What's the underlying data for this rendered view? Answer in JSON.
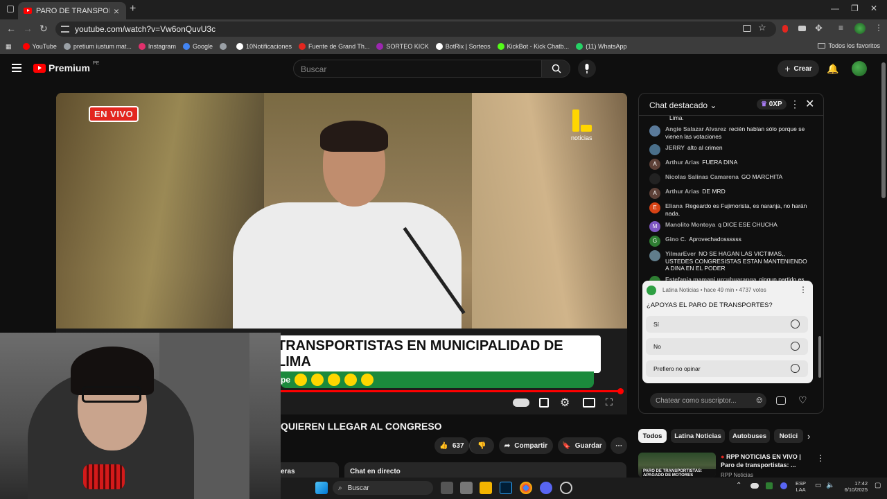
{
  "browser": {
    "tab_title": "PARO DE TRANSPORTE EN LIMA",
    "new_tab": "+",
    "url": "youtube.com/watch?v=Vw6onQuvU3c",
    "bookmarks": [
      {
        "label": "YouTube",
        "color": "#ff0000"
      },
      {
        "label": "pretium iustum mat...",
        "color": "#9aa0a6"
      },
      {
        "label": "Instagram",
        "color": "#e1306c"
      },
      {
        "label": "Google",
        "color": "#4285f4"
      },
      {
        "label": "",
        "color": "#9aa0a6"
      },
      {
        "label": "10Notificaciones",
        "color": "#ffffff"
      },
      {
        "label": "Fuente de Grand Th...",
        "color": "#e3261f"
      },
      {
        "label": "SORTEO KICK",
        "color": "#9c27b0"
      },
      {
        "label": "BotRix | Sorteos",
        "color": "#ffffff"
      },
      {
        "label": "KickBot - Kick Chatb...",
        "color": "#53fc18"
      },
      {
        "label": "(11) WhatsApp",
        "color": "#25d366"
      }
    ],
    "all_bookmarks": "Todos los favoritos"
  },
  "youtube": {
    "brand": "Premium",
    "region": "PE",
    "search_placeholder": "Buscar",
    "create_label": "Crear"
  },
  "video": {
    "live_badge": "EN VIVO",
    "channel_logo_text": "noticias",
    "headline_text": "TRANSPORTISTAS EN MUNICIPALIDAD DE LIMA",
    "social_prefix": "pe",
    "title": "QUIEREN LLEGAR AL CONGRESO",
    "likes": "637",
    "share_label": "Compartir",
    "save_label": "Guardar",
    "desc_tab": "eras",
    "chat_live_label": "Chat en directo"
  },
  "chat": {
    "title": "Chat destacado",
    "xp": "0XP",
    "messages": [
      {
        "author": "",
        "text": "Lima.",
        "avatar": "",
        "color": "transparent"
      },
      {
        "author": "Angie Salazar Alvarez",
        "text": "recién hablan sólo porque se vienen las votaciones",
        "avatar": "",
        "color": "#5a7a9a"
      },
      {
        "author": "JERRY",
        "text": "alto al crimen",
        "avatar": "",
        "color": "#4a6f8a"
      },
      {
        "author": "Arthur Arias",
        "text": "FUERA DINA",
        "avatar": "A",
        "color": "#5d4037"
      },
      {
        "author": "Nicolas Salinas Camarena",
        "text": "GO MARCHITA",
        "avatar": "",
        "color": "#222222"
      },
      {
        "author": "Arthur Arias",
        "text": "DE MRD",
        "avatar": "A",
        "color": "#5d4037"
      },
      {
        "author": "Eliana",
        "text": "Regeardo es Fujimorista, es naranja, no harán nada.",
        "avatar": "E",
        "color": "#d84315"
      },
      {
        "author": "Manolito Montoya",
        "text": "q DICE ESE CHUCHA",
        "avatar": "M",
        "color": "#7e57c2"
      },
      {
        "author": "Gino C.",
        "text": "Aprovechadossssss",
        "avatar": "G",
        "color": "#2e7d32"
      },
      {
        "author": "YilmarEver",
        "text": "NO SE HAGAN LAS VICTIMAS,, USTEDES CONGRESISTAS ESTAN MANTENIENDO A DINA EN EL PODER",
        "avatar": "",
        "color": "#607d8b"
      },
      {
        "author": "Estefania mamani urcuhuaranga",
        "text": "ningun partido es",
        "avatar": "",
        "color": "#2e7d32"
      }
    ],
    "poll": {
      "meta": "Latina Noticias • hace 49 min • 4737 votos",
      "question": "¿APOYAS EL PARO DE TRANSPORTES?",
      "options": [
        "Sí",
        "No",
        "Prefiero no opinar"
      ]
    },
    "input_placeholder": "Chatear como suscriptor..."
  },
  "related": {
    "chips": [
      "Todos",
      "Latina Noticias",
      "Autobuses",
      "Notici"
    ],
    "video_title": "RPP NOTICIAS EN VIVO | Paro de transportistas: ...",
    "channel": "RPP Noticias",
    "thumb_text": "PARO DE TRANSPORTISTAS: APAGADO DE MOTORES"
  },
  "taskbar": {
    "search_label": "Buscar",
    "lang_1": "ESP",
    "lang_2": "LAA",
    "time": "17:42",
    "date": "6/10/2025"
  }
}
